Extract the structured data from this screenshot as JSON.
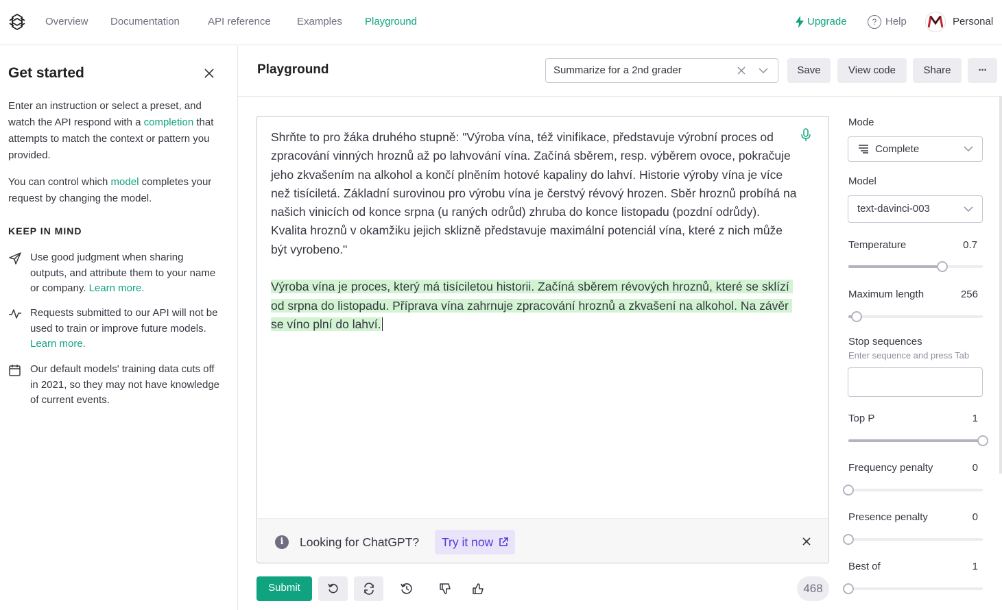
{
  "nav": {
    "links": [
      "Overview",
      "Documentation",
      "API reference",
      "Examples",
      "Playground"
    ],
    "upgrade": "Upgrade",
    "help": "Help",
    "account": "Personal"
  },
  "sidebar": {
    "title": "Get started",
    "intro_pre": "Enter an instruction or select a preset, and watch the API respond with a ",
    "intro_link": "completion",
    "intro_post": " that attempts to match the context or pattern you provided.",
    "model_pre": "You can control which ",
    "model_link": "model",
    "model_post": " completes your request by changing the model.",
    "keep_in_mind": "KEEP IN MIND",
    "tips": [
      {
        "text": "Use good judgment when sharing outputs, and attribute them to your name or company. ",
        "link": "Learn more."
      },
      {
        "text": "Requests submitted to our API will not be used to train or improve future models. ",
        "link": "Learn more."
      },
      {
        "text": "Our default models' training data cuts off in 2021, so they may not have knowledge of current events.",
        "link": ""
      }
    ]
  },
  "header": {
    "title": "Playground",
    "preset": "Summarize for a 2nd grader",
    "save": "Save",
    "view_code": "View code",
    "share": "Share",
    "more": "···"
  },
  "editor": {
    "prompt": "Shrňte to pro žáka druhého stupně: \"Výroba vína, též vinifikace, představuje výrobní proces od zpracování vinných hroznů až po lahvování vína. Začíná sběrem, resp. výběrem ovoce, pokračuje jeho zkvašením na alkohol a končí plněním hotové kapaliny do lahví. Historie výroby vína je více než tisíciletá. Základní surovinou pro výrobu vína je čerstvý révový hrozen. Sběr hroznů probíhá na našich vinicích od konce srpna (u raných odrůd) zhruba do konce listopadu (pozdní odrůdy). Kvalita hroznů v okamžiku jejich sklizně představuje maximální potenciál vína, které z nich může být vyrobeno.\"",
    "completion": "Výroba vína je proces, který má tisíciletou historii. Začíná sběrem révových hroznů, které se sklízí od srpna do listopadu. Příprava vína zahrnuje zpracování hroznů a zkvašení na alkohol. Na závěr se víno plní do lahví."
  },
  "banner": {
    "text": "Looking for ChatGPT?",
    "cta": "Try it now"
  },
  "actions": {
    "submit": "Submit",
    "token_count": "468"
  },
  "settings": {
    "mode_label": "Mode",
    "mode_value": "Complete",
    "model_label": "Model",
    "model_value": "text-davinci-003",
    "stop_label": "Stop sequences",
    "stop_hint": "Enter sequence and press Tab",
    "sliders": [
      {
        "label": "Temperature",
        "value": "0.7",
        "fraction": 0.7
      },
      {
        "label": "Maximum length",
        "value": "256",
        "fraction": 0.06
      },
      {
        "label": "Top P",
        "value": "1",
        "fraction": 1.0
      },
      {
        "label": "Frequency penalty",
        "value": "0",
        "fraction": 0.0
      },
      {
        "label": "Presence penalty",
        "value": "0",
        "fraction": 0.0
      },
      {
        "label": "Best of",
        "value": "1",
        "fraction": 0.0
      }
    ]
  },
  "colors": {
    "accent": "#10a37f",
    "completion_highlight": "#d2f4d3",
    "cta_bg": "#e9e4fa",
    "cta_text": "#5436da"
  }
}
